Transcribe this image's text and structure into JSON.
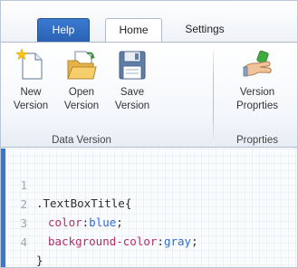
{
  "tabs": [
    {
      "label": "Help"
    },
    {
      "label": "Home"
    },
    {
      "label": "Settings"
    }
  ],
  "ribbon": {
    "buttons": [
      {
        "label": "New\nVersion",
        "icon": "new-document-icon"
      },
      {
        "label": "Open\nVersion",
        "icon": "open-folder-icon"
      },
      {
        "label": "Save\nVersion",
        "icon": "save-floppy-icon"
      },
      {
        "label": "Version\nProprties",
        "icon": "properties-hand-icon"
      }
    ],
    "groups": [
      {
        "label": "Data Version"
      },
      {
        "label": "Proprties"
      }
    ]
  },
  "editor": {
    "lines": [
      {
        "num": "1",
        "selector": ".TextBoxTitle",
        "brace": "{"
      },
      {
        "num": "2",
        "prop": "color",
        "sep": ":",
        "value": "blue",
        "end": ";"
      },
      {
        "num": "3",
        "prop": "background-color",
        "sep": ":",
        "value": "gray",
        "end": ";"
      },
      {
        "num": "4",
        "brace": "}"
      }
    ]
  },
  "colors": {
    "help_tab": "#2a62b4",
    "editor_accent": "#3a78c8",
    "css_property": "#b0306a",
    "css_value": "#2e6bd6"
  }
}
